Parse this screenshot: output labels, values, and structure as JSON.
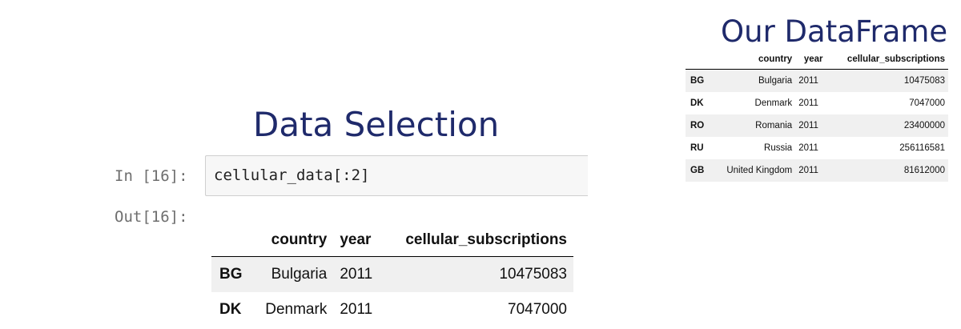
{
  "titles": {
    "right": "Our DataFrame",
    "main": "Data Selection"
  },
  "small_table": {
    "columns": [
      "",
      "country",
      "year",
      "cellular_subscriptions"
    ],
    "rows": [
      {
        "index": "BG",
        "country": "Bulgaria",
        "year": "2011",
        "cellular_subscriptions": "10475083"
      },
      {
        "index": "DK",
        "country": "Denmark",
        "year": "2011",
        "cellular_subscriptions": "7047000"
      },
      {
        "index": "RO",
        "country": "Romania",
        "year": "2011",
        "cellular_subscriptions": "23400000"
      },
      {
        "index": "RU",
        "country": "Russia",
        "year": "2011",
        "cellular_subscriptions": "256116581"
      },
      {
        "index": "GB",
        "country": "United Kingdom",
        "year": "2011",
        "cellular_subscriptions": "81612000"
      }
    ]
  },
  "notebook": {
    "in_prompt": "In [16]:",
    "code": "cellular_data[:2]",
    "out_prompt": "Out[16]:"
  },
  "output_table": {
    "columns": [
      "",
      "country",
      "year",
      "cellular_subscriptions"
    ],
    "rows": [
      {
        "index": "BG",
        "country": "Bulgaria",
        "year": "2011",
        "cellular_subscriptions": "10475083"
      },
      {
        "index": "DK",
        "country": "Denmark",
        "year": "2011",
        "cellular_subscriptions": "7047000"
      }
    ]
  }
}
